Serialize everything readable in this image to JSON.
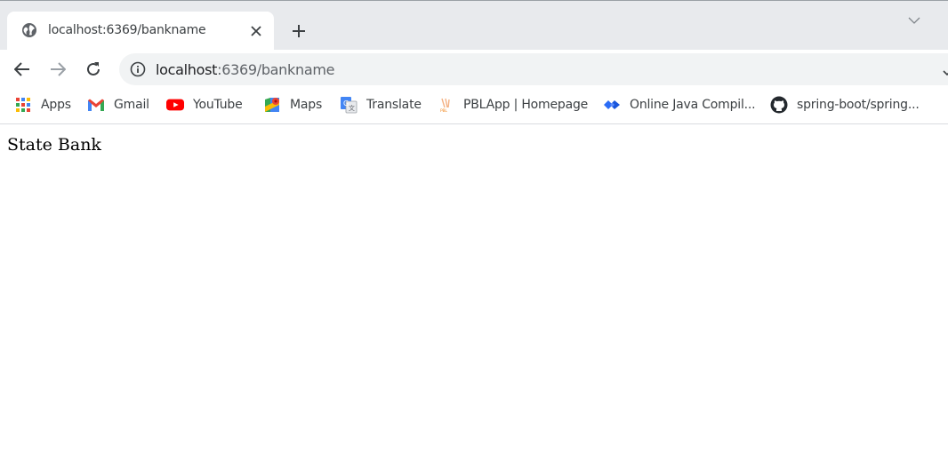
{
  "tab": {
    "title": "localhost:6369/bankname",
    "favicon": "globe-icon"
  },
  "toolbar": {
    "url_host": "localhost",
    "url_path": ":6369/bankname"
  },
  "bookmarks": [
    {
      "label": "Apps",
      "icon": "apps-grid-icon"
    },
    {
      "label": "Gmail",
      "icon": "gmail-icon"
    },
    {
      "label": "YouTube",
      "icon": "youtube-icon"
    },
    {
      "label": "Maps",
      "icon": "maps-icon"
    },
    {
      "label": "Translate",
      "icon": "translate-icon"
    },
    {
      "label": "PBLApp | Homepage",
      "icon": "pbl-icon"
    },
    {
      "label": "Online Java Compil...",
      "icon": "jdoodle-icon"
    },
    {
      "label": "spring-boot/spring...",
      "icon": "github-icon"
    }
  ],
  "page": {
    "text": "State Bank"
  },
  "colors": {
    "tabstrip": "#e8eaed",
    "omnibox": "#f1f3f4",
    "youtube_red": "#ff0000"
  }
}
